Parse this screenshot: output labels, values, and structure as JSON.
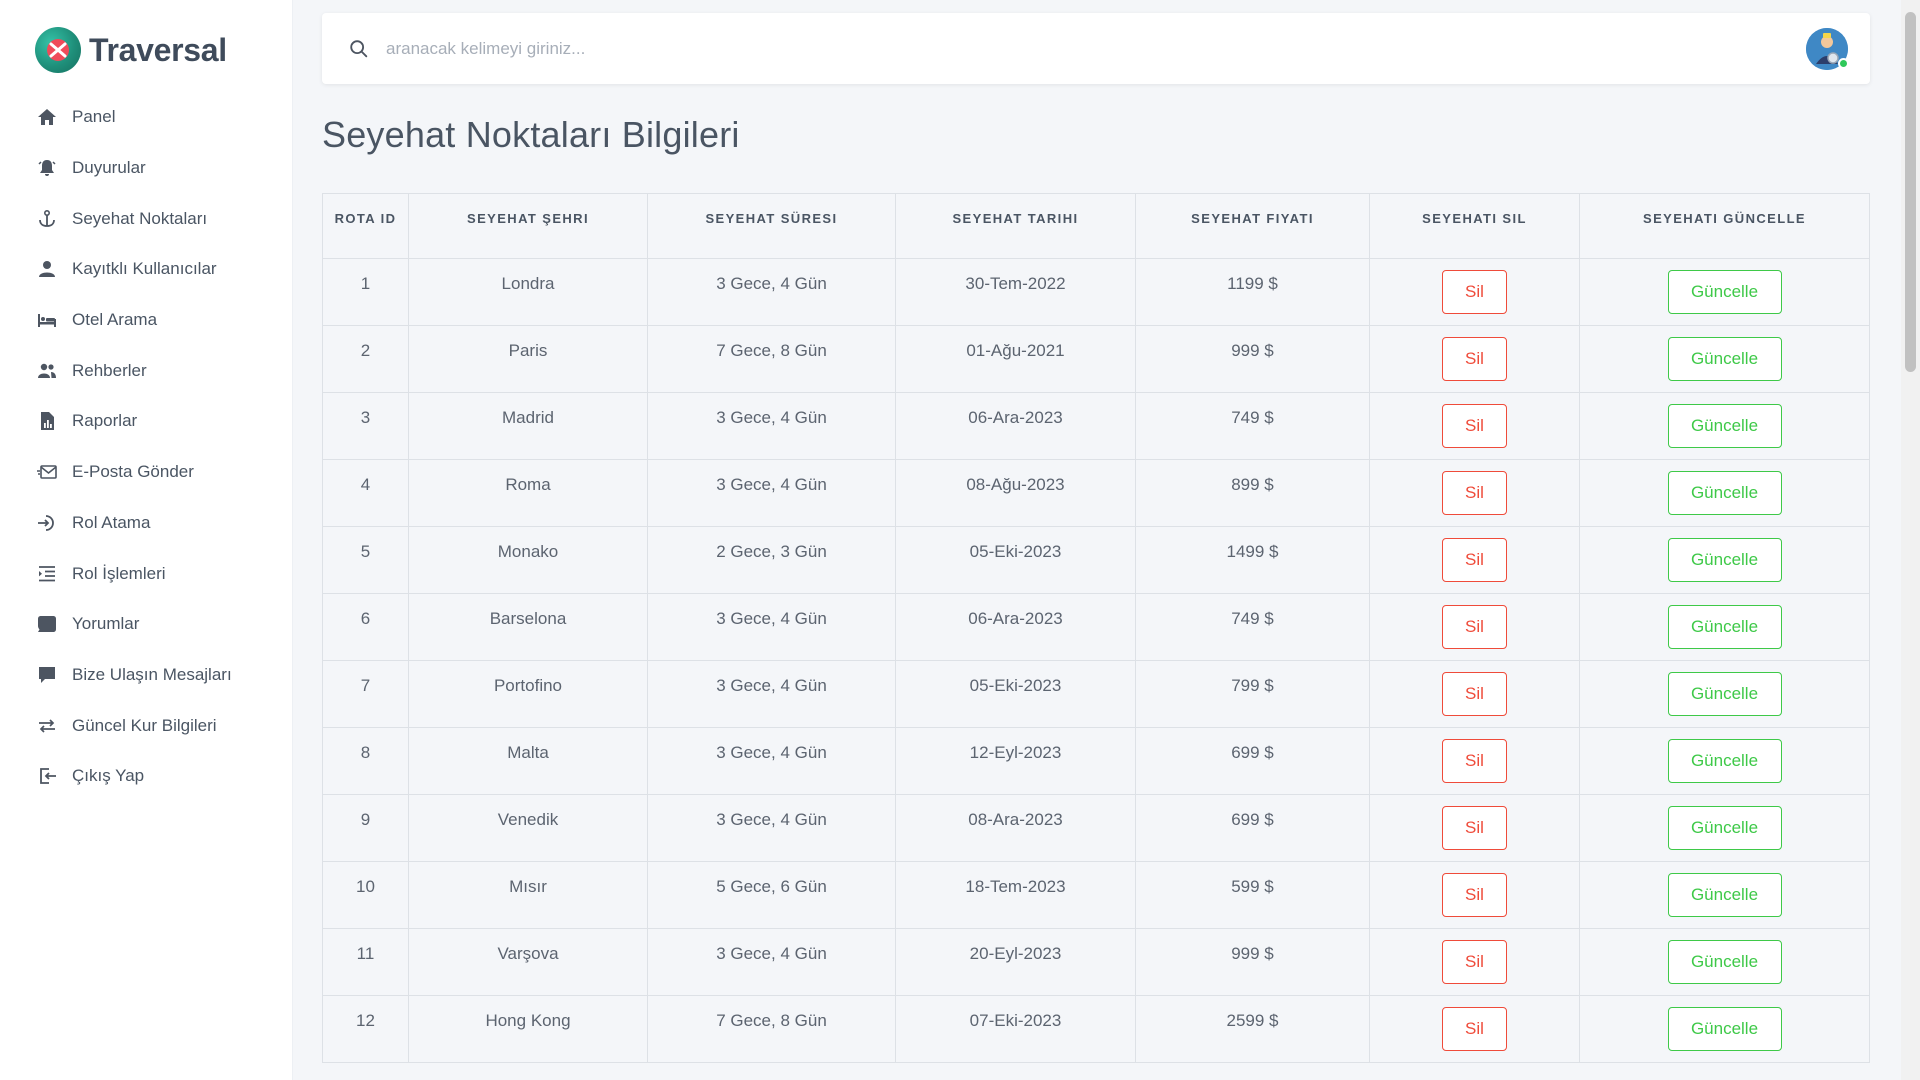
{
  "brand": {
    "name": "Traversal"
  },
  "sidebar": {
    "items": [
      {
        "label": "Panel",
        "icon": "home-icon"
      },
      {
        "label": "Duyurular",
        "icon": "bell-icon"
      },
      {
        "label": "Seyehat Noktaları",
        "icon": "anchor-icon"
      },
      {
        "label": "Kayıtklı Kullanıcılar",
        "icon": "user-icon"
      },
      {
        "label": "Otel Arama",
        "icon": "bed-icon"
      },
      {
        "label": "Rehberler",
        "icon": "users-icon"
      },
      {
        "label": "Raporlar",
        "icon": "report-icon"
      },
      {
        "label": "E-Posta Gönder",
        "icon": "mail-send-icon"
      },
      {
        "label": "Rol Atama",
        "icon": "sign-in-icon"
      },
      {
        "label": "Rol İşlemleri",
        "icon": "list-indent-icon"
      },
      {
        "label": "Yorumlar",
        "icon": "comment-icon"
      },
      {
        "label": "Bize Ulaşın Mesajları",
        "icon": "message-icon"
      },
      {
        "label": "Güncel Kur Bilgileri",
        "icon": "exchange-icon"
      },
      {
        "label": "Çıkış Yap",
        "icon": "sign-out-icon"
      }
    ]
  },
  "search": {
    "placeholder": "aranacak kelimeyi giriniz..."
  },
  "page": {
    "title": "Seyehat Noktaları Bilgileri"
  },
  "table": {
    "headers": [
      "ROTA ID",
      "SEYEHAT ŞEHRI",
      "SEYEHAT SÜRESI",
      "SEYEHAT TARIHI",
      "SEYEHAT FIYATI",
      "SEYEHATI SIL",
      "SEYEHATI GÜNCELLE"
    ],
    "delete_label": "Sil",
    "update_label": "Güncelle",
    "rows": [
      {
        "id": "1",
        "city": "Londra",
        "duration": "3 Gece, 4 Gün",
        "date": "30-Tem-2022",
        "price": "1199 $"
      },
      {
        "id": "2",
        "city": "Paris",
        "duration": "7 Gece, 8 Gün",
        "date": "01-Ağu-2021",
        "price": "999 $"
      },
      {
        "id": "3",
        "city": "Madrid",
        "duration": "3 Gece, 4 Gün",
        "date": "06-Ara-2023",
        "price": "749 $"
      },
      {
        "id": "4",
        "city": "Roma",
        "duration": "3 Gece, 4 Gün",
        "date": "08-Ağu-2023",
        "price": "899 $"
      },
      {
        "id": "5",
        "city": "Monako",
        "duration": "2 Gece, 3 Gün",
        "date": "05-Eki-2023",
        "price": "1499 $"
      },
      {
        "id": "6",
        "city": "Barselona",
        "duration": "3 Gece, 4 Gün",
        "date": "06-Ara-2023",
        "price": "749 $"
      },
      {
        "id": "7",
        "city": "Portofino",
        "duration": "3 Gece, 4 Gün",
        "date": "05-Eki-2023",
        "price": "799 $"
      },
      {
        "id": "8",
        "city": "Malta",
        "duration": "3 Gece, 4 Gün",
        "date": "12-Eyl-2023",
        "price": "699 $"
      },
      {
        "id": "9",
        "city": "Venedik",
        "duration": "3 Gece, 4 Gün",
        "date": "08-Ara-2023",
        "price": "699 $"
      },
      {
        "id": "10",
        "city": "Mısır",
        "duration": "5 Gece, 6 Gün",
        "date": "18-Tem-2023",
        "price": "599 $"
      },
      {
        "id": "11",
        "city": "Varşova",
        "duration": "3 Gece, 4 Gün",
        "date": "20-Eyl-2023",
        "price": "999 $"
      },
      {
        "id": "12",
        "city": "Hong Kong",
        "duration": "7 Gece, 8 Gün",
        "date": "07-Eki-2023",
        "price": "2599 $"
      }
    ]
  },
  "colors": {
    "delete": "#ef4b3a",
    "update": "#3ec948",
    "status_online": "#2fc85a",
    "brand_logo": "#1f8f7a"
  }
}
